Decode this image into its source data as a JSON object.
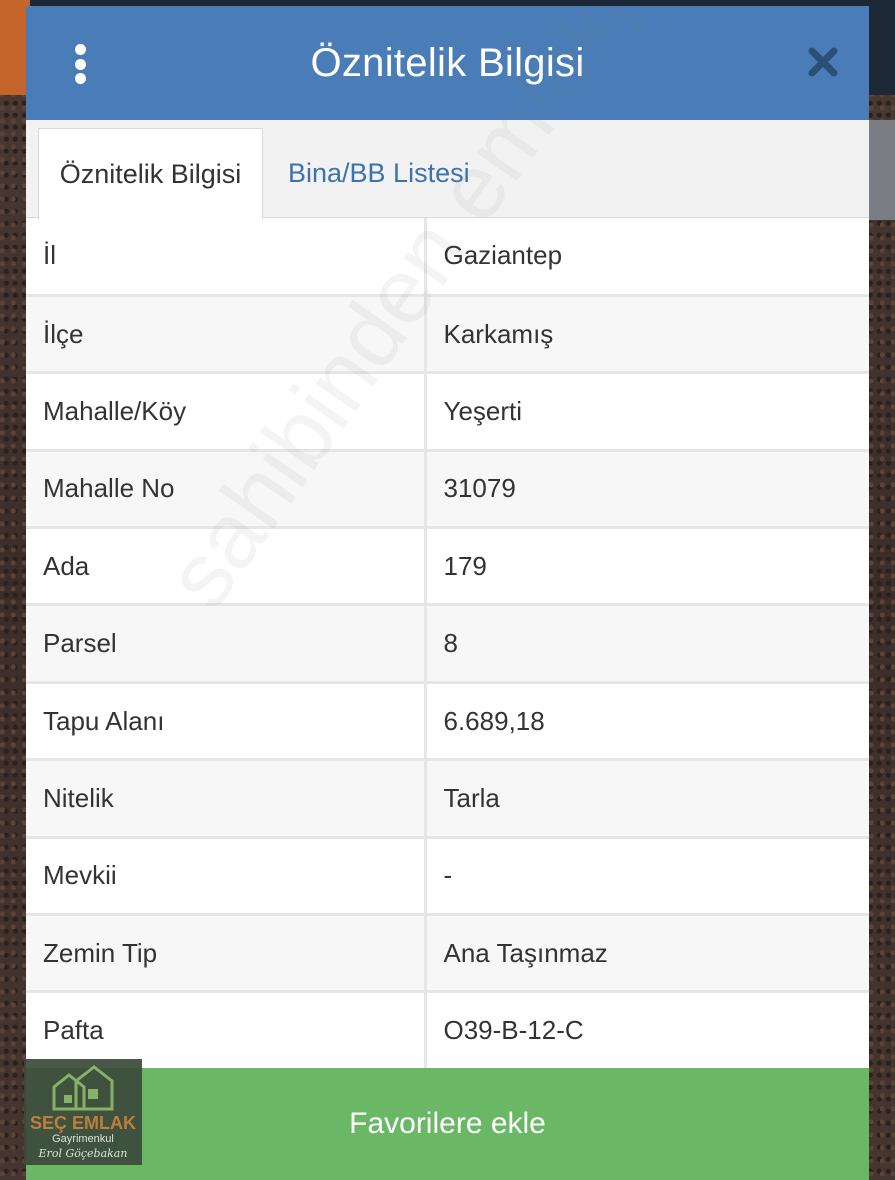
{
  "header": {
    "title": "Öznitelik Bilgisi",
    "menu_icon": "kebab-menu-icon",
    "close_icon": "close-icon"
  },
  "tabs": [
    {
      "label": "Öznitelik Bilgisi",
      "active": true
    },
    {
      "label": "Bina/BB Listesi",
      "active": false
    }
  ],
  "attributes": [
    {
      "key": "İl",
      "value": "Gaziantep"
    },
    {
      "key": "İlçe",
      "value": "Karkamış"
    },
    {
      "key": "Mahalle/Köy",
      "value": "Yeşerti"
    },
    {
      "key": "Mahalle No",
      "value": "31079"
    },
    {
      "key": "Ada",
      "value": "179"
    },
    {
      "key": "Parsel",
      "value": "8"
    },
    {
      "key": "Tapu Alanı",
      "value": "6.689,18"
    },
    {
      "key": "Nitelik",
      "value": "Tarla"
    },
    {
      "key": "Mevkii",
      "value": "-"
    },
    {
      "key": "Zemin Tip",
      "value": "Ana Taşınmaz"
    },
    {
      "key": "Pafta",
      "value": "O39-B-12-C"
    }
  ],
  "footer": {
    "button_label": "Favorilere ekle"
  },
  "watermark": "sahibinden emlakjet.com",
  "logo": {
    "name": "SEÇ EMLAK",
    "subtitle": "Gayrimenkul",
    "signature": "Erol Göçebakan"
  },
  "colors": {
    "header": "#4a7db8",
    "tab_link": "#3b73ad",
    "footer_button": "#6ab865"
  }
}
